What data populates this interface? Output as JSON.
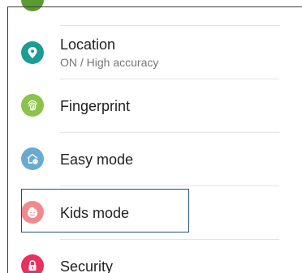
{
  "settings": {
    "items": [
      {
        "label": "Location",
        "sublabel": "ON / High accuracy",
        "icon": "location-pin-icon",
        "color": "#1a9d93"
      },
      {
        "label": "Fingerprint",
        "icon": "fingerprint-icon",
        "color": "#8bc34a"
      },
      {
        "label": "Easy mode",
        "icon": "easy-mode-home-icon",
        "color": "#6aaad0"
      },
      {
        "label": "Kids mode",
        "icon": "kids-face-icon",
        "color": "#f08a8e",
        "focused": true
      },
      {
        "label": "Security",
        "icon": "lock-icon",
        "color": "#e8315c"
      }
    ],
    "previous_item_icon_color": "#5b9a31"
  }
}
